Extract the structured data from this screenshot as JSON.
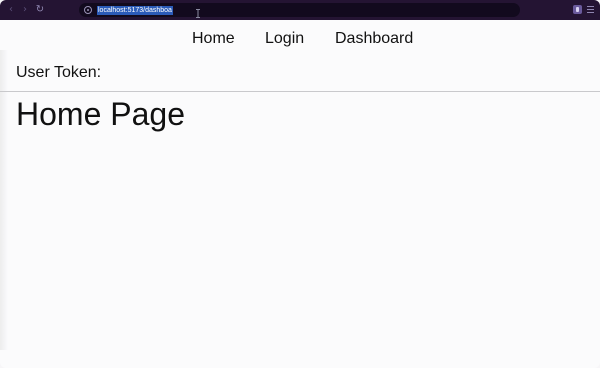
{
  "browser": {
    "url": "localhost:5173/dashboa",
    "back_icon": "arrow-left",
    "forward_icon": "arrow-right",
    "reload_icon": "reload",
    "site_info_icon": "site-info",
    "extension_icon": "extension",
    "menu_icon": "hamburger-menu"
  },
  "nav": {
    "items": [
      {
        "label": "Home"
      },
      {
        "label": "Login"
      },
      {
        "label": "Dashboard"
      }
    ]
  },
  "token": {
    "label": "User Token:",
    "value": ""
  },
  "main": {
    "title": "Home Page"
  },
  "colors": {
    "chrome_bg": "#241433",
    "omnibox_bg": "#120a1e",
    "url_highlight": "#2b5bb8",
    "page_bg": "#fbfbfc",
    "text": "#111111"
  }
}
